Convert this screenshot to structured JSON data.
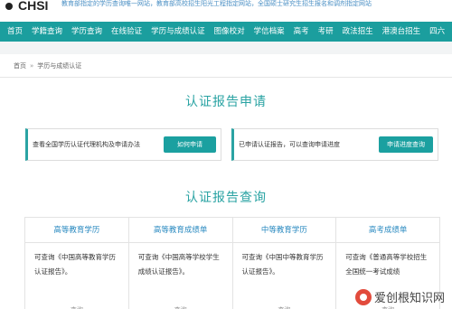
{
  "header": {
    "logo": "CHSI",
    "tagline": "教育部指定的学历查询唯一网站，教育部高校招生阳光工程指定网站，全国硕士研究生招生报名和调剂指定网站"
  },
  "nav": {
    "items": [
      "首页",
      "学籍查询",
      "学历查询",
      "在线验证",
      "学历与成绩认证",
      "图像校对",
      "学信档案",
      "高考",
      "考研",
      "政法招生",
      "港澳台招生",
      "四六"
    ]
  },
  "breadcrumb": {
    "home": "首页",
    "separator": "»",
    "current": "学历与成绩认证"
  },
  "apply": {
    "title": "认证报告申请",
    "panel1_text": "查看全国学历认证代理机构及申请办法",
    "panel1_button": "如何申请",
    "panel2_text": "已申请认证报告，可以查询申请进度",
    "panel2_button": "申请进度查询"
  },
  "query": {
    "title": "认证报告查询",
    "cards": [
      {
        "title": "高等教育学历",
        "body": "可查询《中国高等教育学历认证报告》。",
        "link": "查询"
      },
      {
        "title": "高等教育成绩单",
        "body": "可查询《中国高等学校学生成绩认证报告》。",
        "link": "查询"
      },
      {
        "title": "中等教育学历",
        "body": "可查询《中国中等教育学历认证报告》。",
        "link": "查询"
      },
      {
        "title": "高考成绩单",
        "body": "可查询《普通高等学校招生全国统一考试成绩",
        "link": "查询"
      }
    ]
  },
  "watermark": {
    "text": "爱创根知识网"
  },
  "colors": {
    "nav_bg": "#1b9e9e",
    "accent": "#2aa3a3",
    "card_title": "#2a8ac0"
  }
}
